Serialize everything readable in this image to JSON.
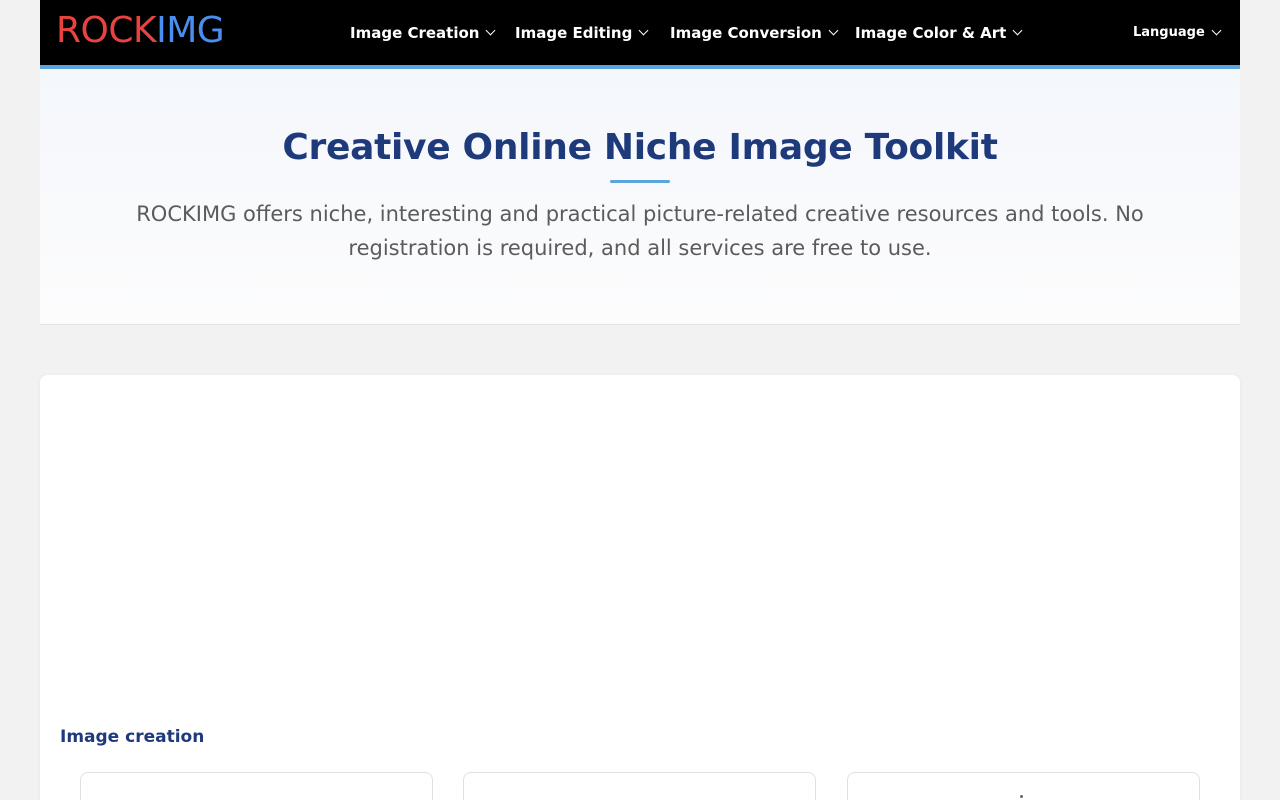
{
  "header": {
    "logo_part1": "ROCK",
    "logo_part2": "IMG",
    "nav": [
      {
        "label": "Image Creation"
      },
      {
        "label": "Image Editing"
      },
      {
        "label": "Image Conversion"
      },
      {
        "label": "Image Color & Art"
      }
    ],
    "language_label": "Language",
    "colors": {
      "bar": "#000000",
      "accent": "#5aa6dc",
      "logo_rock": "#e8433e",
      "logo_img": "#4a8ef0"
    }
  },
  "hero": {
    "title": "Creative Online Niche Image Toolkit",
    "description": "ROCKIMG offers niche, interesting and practical picture-related creative resources and tools. No registration is required, and all services are free to use."
  },
  "main": {
    "section_title": "Image creation",
    "cards_count_visible": 3
  }
}
